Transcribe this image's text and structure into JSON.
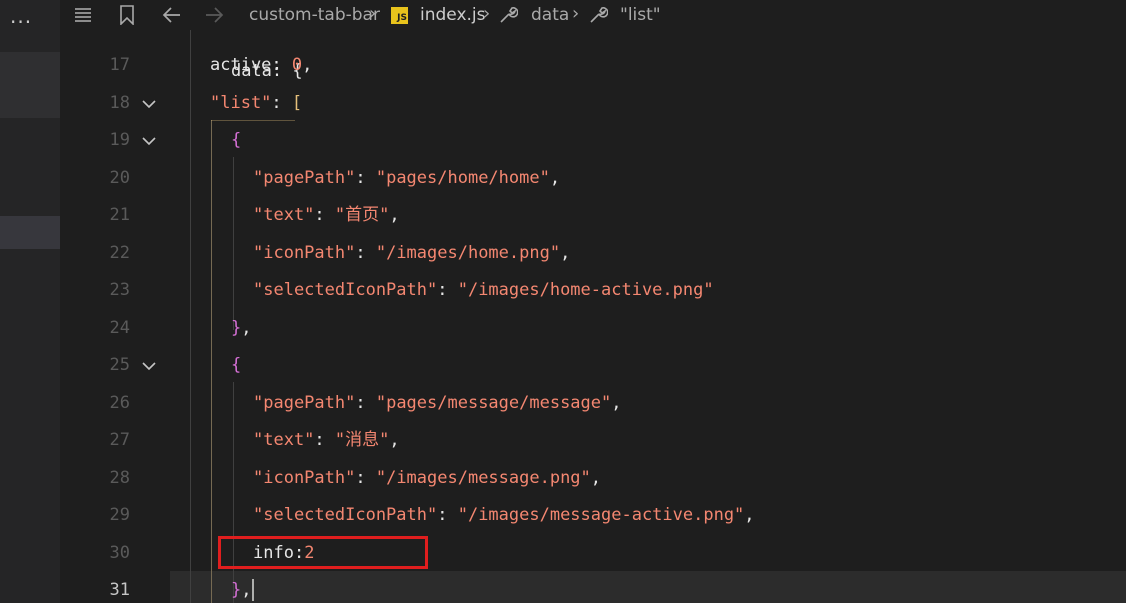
{
  "sidebar": {
    "more_label": "···"
  },
  "breadcrumb": {
    "folder": "custom-tab-bar",
    "file": "index.js",
    "file_icon_text": "JS",
    "symbol1": "data",
    "symbol2": "\"list\""
  },
  "editor": {
    "partial_top_text": "data: {",
    "lines": [
      {
        "num": "17",
        "parts": [
          [
            "ident",
            "active"
          ],
          [
            "punct",
            ": "
          ],
          [
            "num",
            "0"
          ],
          [
            "punct",
            ","
          ]
        ]
      },
      {
        "num": "18",
        "parts": [
          [
            "str",
            "\"list\""
          ],
          [
            "punct",
            ": "
          ],
          [
            "bracket",
            "["
          ]
        ]
      },
      {
        "num": "19",
        "parts": [
          [
            "brace",
            "{"
          ]
        ]
      },
      {
        "num": "20",
        "parts": [
          [
            "str",
            "\"pagePath\""
          ],
          [
            "punct",
            ": "
          ],
          [
            "str",
            "\"pages/home/home\""
          ],
          [
            "punct",
            ","
          ]
        ]
      },
      {
        "num": "21",
        "parts": [
          [
            "str",
            "\"text\""
          ],
          [
            "punct",
            ": "
          ],
          [
            "str",
            "\"首页\""
          ],
          [
            "punct",
            ","
          ]
        ]
      },
      {
        "num": "22",
        "parts": [
          [
            "str",
            "\"iconPath\""
          ],
          [
            "punct",
            ": "
          ],
          [
            "str",
            "\"/images/home.png\""
          ],
          [
            "punct",
            ","
          ]
        ]
      },
      {
        "num": "23",
        "parts": [
          [
            "str",
            "\"selectedIconPath\""
          ],
          [
            "punct",
            ": "
          ],
          [
            "str",
            "\"/images/home-active.png\""
          ]
        ]
      },
      {
        "num": "24",
        "parts": [
          [
            "brace",
            "}"
          ],
          [
            "punct",
            ","
          ]
        ]
      },
      {
        "num": "25",
        "parts": [
          [
            "brace",
            "{"
          ]
        ]
      },
      {
        "num": "26",
        "parts": [
          [
            "str",
            "\"pagePath\""
          ],
          [
            "punct",
            ": "
          ],
          [
            "str",
            "\"pages/message/message\""
          ],
          [
            "punct",
            ","
          ]
        ]
      },
      {
        "num": "27",
        "parts": [
          [
            "str",
            "\"text\""
          ],
          [
            "punct",
            ": "
          ],
          [
            "str",
            "\"消息\""
          ],
          [
            "punct",
            ","
          ]
        ]
      },
      {
        "num": "28",
        "parts": [
          [
            "str",
            "\"iconPath\""
          ],
          [
            "punct",
            ": "
          ],
          [
            "str",
            "\"/images/message.png\""
          ],
          [
            "punct",
            ","
          ]
        ]
      },
      {
        "num": "29",
        "parts": [
          [
            "str",
            "\"selectedIconPath\""
          ],
          [
            "punct",
            ": "
          ],
          [
            "str",
            "\"/images/message-active.png\""
          ],
          [
            "punct",
            ","
          ]
        ]
      },
      {
        "num": "30",
        "parts": [
          [
            "ident",
            "info"
          ],
          [
            "punct",
            ":"
          ],
          [
            "num",
            "2"
          ]
        ]
      },
      {
        "num": "31",
        "parts": [
          [
            "brace",
            "}"
          ],
          [
            "punct",
            ","
          ]
        ]
      }
    ],
    "folded_lines": [
      "18",
      "19",
      "25"
    ],
    "current_line": "31",
    "highlighted_line": "30"
  }
}
